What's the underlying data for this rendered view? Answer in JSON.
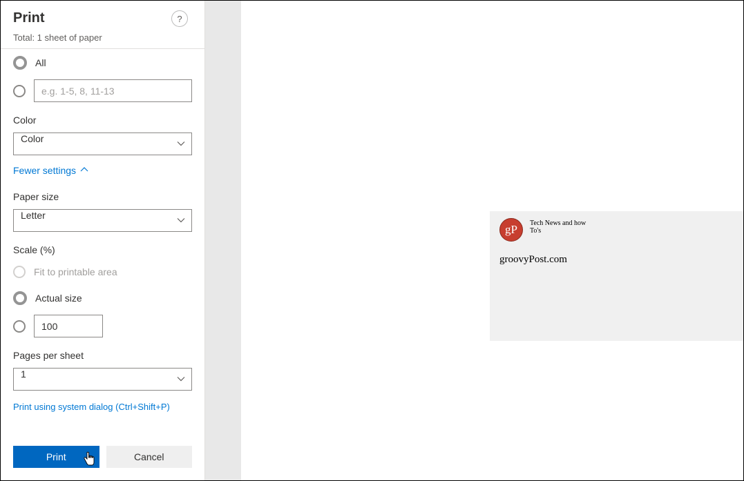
{
  "header": {
    "title": "Print",
    "subtitle": "Total: 1 sheet of paper",
    "help": "?"
  },
  "pages": {
    "all_label": "All",
    "range_placeholder": "e.g. 1-5, 8, 11-13"
  },
  "color": {
    "label": "Color",
    "value": "Color"
  },
  "fewer_settings": "Fewer settings",
  "paper_size": {
    "label": "Paper size",
    "value": "Letter"
  },
  "scale": {
    "label": "Scale (%)",
    "fit_label": "Fit to printable area",
    "actual_label": "Actual size",
    "value": "100"
  },
  "pps": {
    "label": "Pages per sheet",
    "value": "1"
  },
  "system_link": "Print using system dialog (Ctrl+Shift+P)",
  "footer": {
    "print": "Print",
    "cancel": "Cancel"
  },
  "preview": {
    "logo_text": "gP",
    "tagline": "Tech News and how To's",
    "site": "groovyPost.com"
  }
}
